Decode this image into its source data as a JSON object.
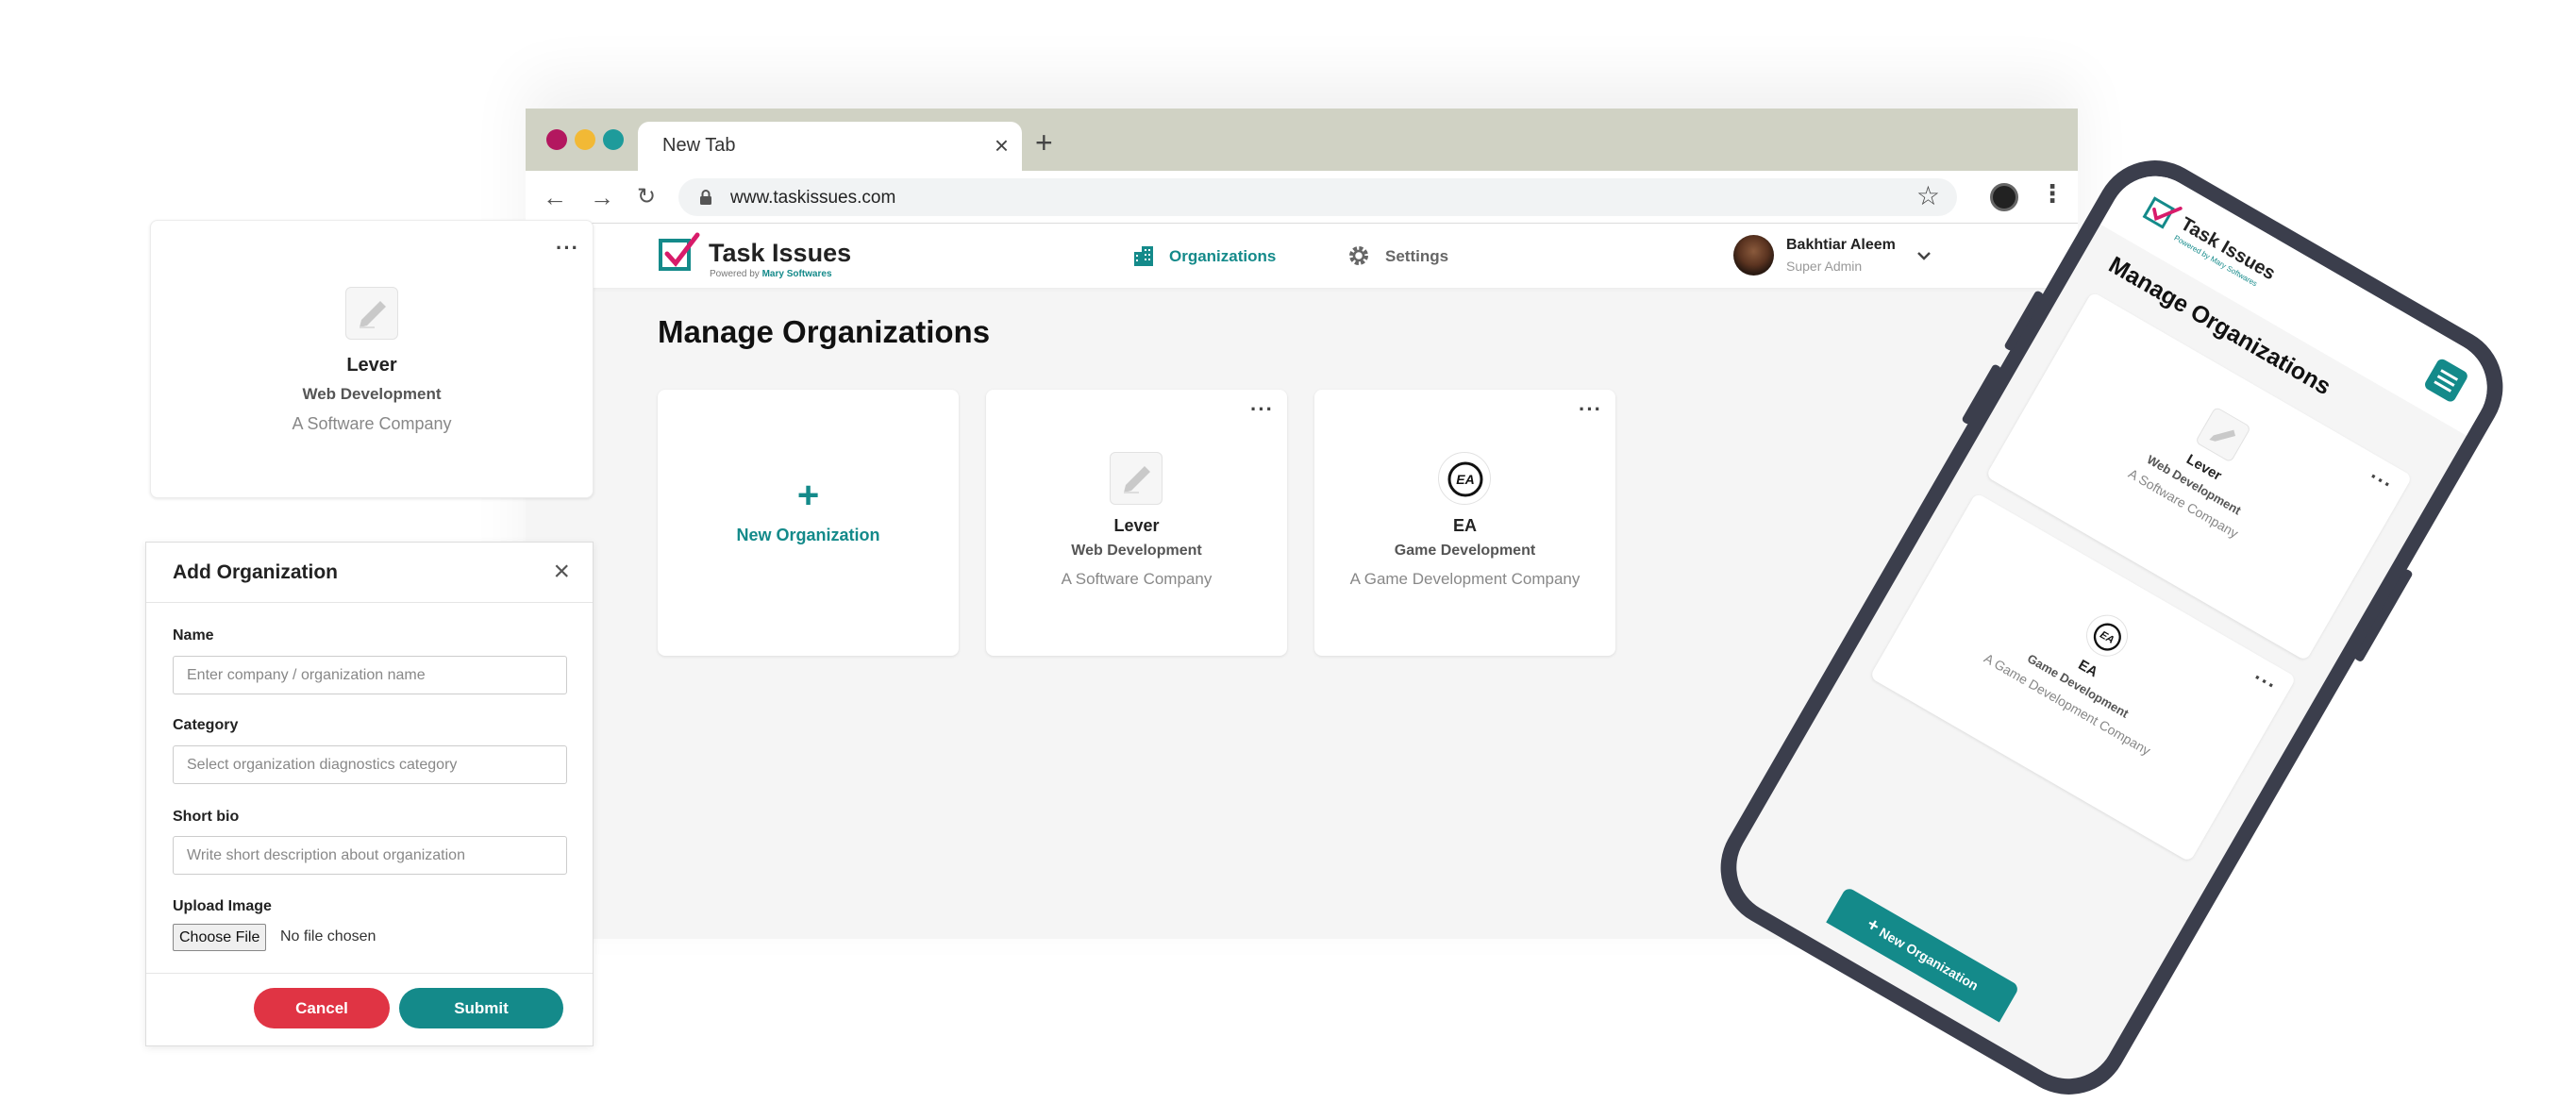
{
  "browser": {
    "tab_title": "New Tab",
    "url": "www.taskissues.com",
    "traffic_colors": [
      "#b3175f",
      "#f2b935",
      "#1e9b9b"
    ]
  },
  "app": {
    "brand": "Task Issues",
    "powered_prefix": "Powered by",
    "powered_by": "Mary Softwares",
    "nav": {
      "organizations": "Organizations",
      "settings": "Settings"
    },
    "user": {
      "name": "Bakhtiar Aleem",
      "role": "Super Admin"
    },
    "page_title": "Manage Organizations",
    "new_org_label": "New Organization",
    "organizations": [
      {
        "name": "Lever",
        "category": "Web Development",
        "description": "A Software Company",
        "logo": "pencil-icon"
      },
      {
        "name": "EA",
        "category": "Game Development",
        "description": "A Game Development Company",
        "logo": "ea-logo"
      }
    ],
    "accent": "#148a8a"
  },
  "floating_card": {
    "name": "Lever",
    "category": "Web Development",
    "description": "A Software Company"
  },
  "modal": {
    "title": "Add Organization",
    "name_label": "Name",
    "name_placeholder": "Enter company / organization name",
    "category_label": "Category",
    "category_placeholder": "Select organization diagnostics category",
    "bio_label": "Short bio",
    "bio_placeholder": "Write short description about organization",
    "upload_label": "Upload Image",
    "choose_file": "Choose File",
    "no_file": "No file chosen",
    "cancel": "Cancel",
    "submit": "Submit",
    "cancel_color": "#e03444",
    "submit_color": "#148a8a"
  },
  "phone": {
    "brand": "Task Issues",
    "powered": "Powered by Mary Softwares",
    "title": "Manage Organizations",
    "cards": [
      {
        "name": "Lever",
        "category": "Web Development",
        "description": "A Software Company"
      },
      {
        "name": "EA",
        "category": "Game Development",
        "description": "A Game Development Company"
      }
    ],
    "new_org": "New Organization"
  }
}
